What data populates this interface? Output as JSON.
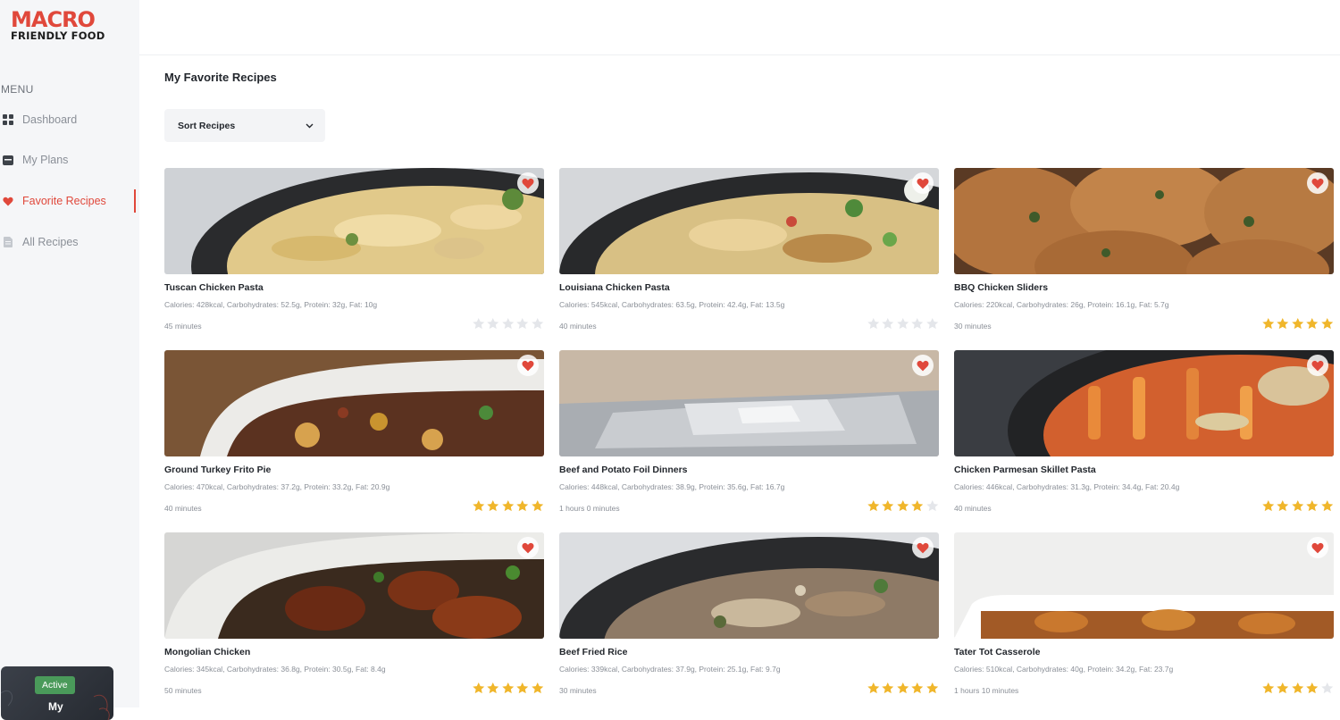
{
  "brand": {
    "line1": "MACRO",
    "line2": "FRIENDLY FOOD"
  },
  "sidebar": {
    "menu_title": "MENU",
    "items": [
      {
        "label": "Dashboard",
        "icon": "grid-icon",
        "active": false
      },
      {
        "label": "My Plans",
        "icon": "folder-icon",
        "active": false
      },
      {
        "label": "Favorite Recipes",
        "icon": "heart-icon",
        "active": true
      },
      {
        "label": "All Recipes",
        "icon": "document-icon",
        "active": false
      }
    ],
    "plan_card": {
      "badge": "Active",
      "title": "My"
    }
  },
  "page": {
    "title": "My Favorite Recipes",
    "sort_label": "Sort Recipes"
  },
  "colors": {
    "accent": "#e0483b",
    "star_on": "#f0b62b",
    "star_off": "#e4e6ea",
    "sidebar_bg": "#f5f6f8"
  },
  "recipes": [
    {
      "name": "Tuscan Chicken Pasta",
      "macros": "Calories: 428kcal, Carbohydrates: 52.5g, Protein: 32g, Fat: 10g",
      "time": "45 minutes",
      "rating": 0
    },
    {
      "name": "Louisiana Chicken Pasta",
      "macros": "Calories: 545kcal, Carbohydrates: 63.5g, Protein: 42.4g, Fat: 13.5g",
      "time": "40 minutes",
      "rating": 0
    },
    {
      "name": "BBQ Chicken Sliders",
      "macros": "Calories: 220kcal, Carbohydrates: 26g, Protein: 16.1g, Fat: 5.7g",
      "time": "30 minutes",
      "rating": 5
    },
    {
      "name": "Ground Turkey Frito Pie",
      "macros": "Calories: 470kcal, Carbohydrates: 37.2g, Protein: 33.2g, Fat: 20.9g",
      "time": "40 minutes",
      "rating": 5
    },
    {
      "name": "Beef and Potato Foil Dinners",
      "macros": "Calories: 448kcal, Carbohydrates: 38.9g, Protein: 35.6g, Fat: 16.7g",
      "time": "1 hours 0 minutes",
      "rating": 4
    },
    {
      "name": "Chicken Parmesan Skillet Pasta",
      "macros": "Calories: 446kcal, Carbohydrates: 31.3g, Protein: 34.4g, Fat: 20.4g",
      "time": "40 minutes",
      "rating": 5
    },
    {
      "name": "Mongolian Chicken",
      "macros": "Calories: 345kcal, Carbohydrates: 36.8g, Protein: 30.5g, Fat: 8.4g",
      "time": "50 minutes",
      "rating": 5
    },
    {
      "name": "Beef Fried Rice",
      "macros": "Calories: 339kcal, Carbohydrates: 37.9g, Protein: 25.1g, Fat: 9.7g",
      "time": "30 minutes",
      "rating": 5
    },
    {
      "name": "Tater Tot Casserole",
      "macros": "Calories: 510kcal, Carbohydrates: 40g, Protein: 34.2g, Fat: 23.7g",
      "time": "1 hours 10 minutes",
      "rating": 4
    }
  ]
}
